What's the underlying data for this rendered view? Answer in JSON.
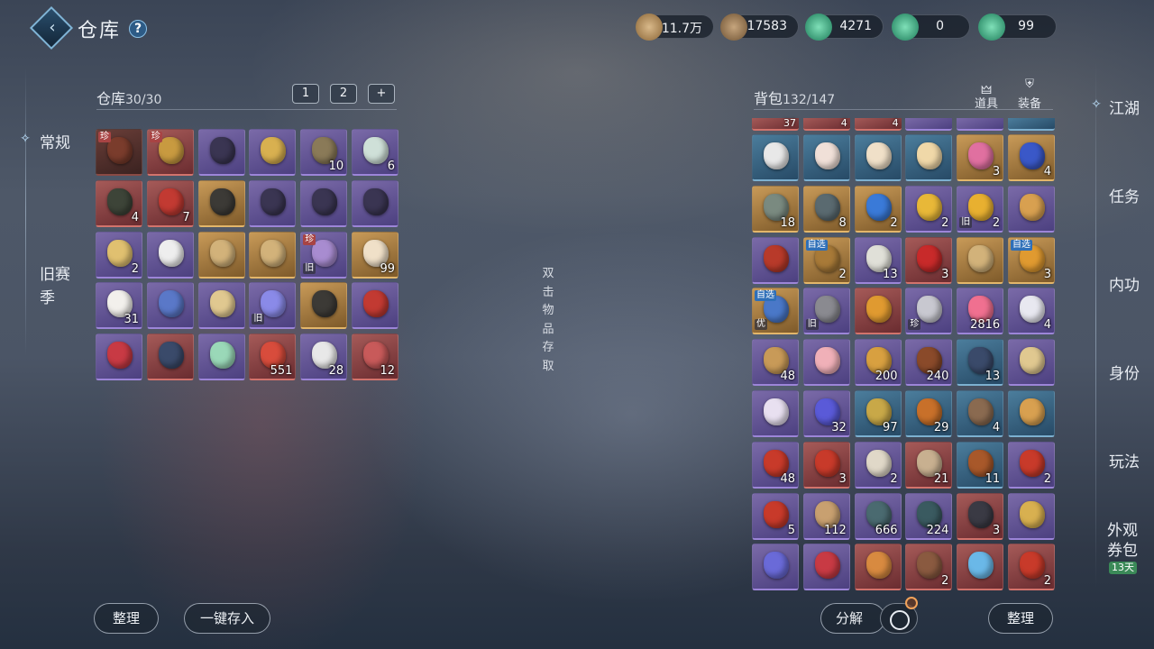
{
  "header": {
    "title": "仓库",
    "help_icon": "?"
  },
  "currencies": [
    {
      "icon": "scroll-currency-icon",
      "value": "11.7万"
    },
    {
      "icon": "coin-currency-icon",
      "value": "17583"
    },
    {
      "icon": "jade-currency-icon",
      "value": "4271"
    },
    {
      "icon": "jade-currency-icon",
      "value": "0"
    },
    {
      "icon": "jade-currency-icon",
      "value": "99"
    }
  ],
  "left_tabs": [
    "常规",
    "旧赛季"
  ],
  "warehouse": {
    "title": "仓库",
    "count": "30/30",
    "filters": [
      "1",
      "2",
      "+"
    ],
    "items": [
      {
        "q": "dim",
        "tag": "珍",
        "num": "",
        "c": "#7a3c2c"
      },
      {
        "q": "red",
        "tag": "珍",
        "num": "",
        "c": "#c89a40"
      },
      {
        "q": "purple",
        "tag": "",
        "num": "",
        "c": "#3a3552"
      },
      {
        "q": "purple",
        "tag": "",
        "num": "",
        "c": "#d8b050"
      },
      {
        "q": "purple",
        "tag": "",
        "num": "10",
        "c": "#8a7a58"
      },
      {
        "q": "purple",
        "tag": "",
        "num": "6",
        "c": "#cfe0d8"
      },
      {
        "q": "red",
        "tag": "",
        "num": "4",
        "c": "#3d4438"
      },
      {
        "q": "red",
        "tag": "",
        "num": "7",
        "c": "#c23a32"
      },
      {
        "q": "gold",
        "tag": "",
        "num": "",
        "c": "#3c3a36"
      },
      {
        "q": "purple",
        "tag": "",
        "num": "",
        "c": "#3a3552"
      },
      {
        "q": "purple",
        "tag": "",
        "num": "",
        "c": "#3a3552"
      },
      {
        "q": "purple",
        "tag": "",
        "num": "",
        "c": "#3a3552"
      },
      {
        "q": "purple",
        "tag": "",
        "num": "2",
        "c": "#e0c070"
      },
      {
        "q": "purple",
        "tag": "",
        "num": "",
        "c": "#eeeeee"
      },
      {
        "q": "gold",
        "tag": "",
        "num": "",
        "c": "#d2b27a"
      },
      {
        "q": "gold",
        "tag": "",
        "num": "",
        "c": "#d2b27a"
      },
      {
        "q": "purple",
        "tag": "珍",
        "tag2": "旧",
        "num": "",
        "c": "#a88cd0"
      },
      {
        "q": "gold",
        "tag": "",
        "num": "99",
        "c": "#f0e0c8"
      },
      {
        "q": "purple",
        "tag": "",
        "num": "31",
        "c": "#f2f0ec"
      },
      {
        "q": "purple",
        "tag": "",
        "num": "",
        "c": "#5a78c8"
      },
      {
        "q": "purple",
        "tag": "",
        "num": "",
        "c": "#e0c890"
      },
      {
        "q": "purple",
        "tag": "",
        "tag2": "旧",
        "num": "",
        "c": "#8a8ae8"
      },
      {
        "q": "gold",
        "tag": "",
        "num": "",
        "c": "#3c3a36"
      },
      {
        "q": "purple",
        "tag": "",
        "num": "",
        "c": "#c23a32"
      },
      {
        "q": "purple",
        "tag": "",
        "num": "",
        "c": "#c83a44"
      },
      {
        "q": "red",
        "tag": "",
        "num": "",
        "c": "#3a4a6a"
      },
      {
        "q": "purple",
        "tag": "",
        "num": "",
        "c": "#9ad8b8"
      },
      {
        "q": "red",
        "tag": "",
        "num": "551",
        "c": "#d84c3c"
      },
      {
        "q": "purple",
        "tag": "",
        "num": "28",
        "c": "#e8e8e8"
      },
      {
        "q": "red",
        "tag": "",
        "num": "12",
        "c": "#c85a5a"
      }
    ]
  },
  "middle_hint": [
    "双",
    "击",
    "物",
    "品",
    "存",
    "取"
  ],
  "bag": {
    "title": "背包",
    "count": "132/147",
    "categories": [
      "道具",
      "装备"
    ],
    "partial_row": [
      {
        "q": "red",
        "num": "37"
      },
      {
        "q": "red",
        "num": "4"
      },
      {
        "q": "red",
        "num": "4"
      },
      {
        "q": "purple",
        "num": ""
      },
      {
        "q": "purple",
        "num": ""
      },
      {
        "q": "blue",
        "num": ""
      }
    ],
    "items": [
      {
        "q": "blue",
        "num": "",
        "c": "#e8e8e8"
      },
      {
        "q": "blue",
        "num": "",
        "c": "#f0e0d8"
      },
      {
        "q": "blue",
        "num": "",
        "c": "#f0e0c8"
      },
      {
        "q": "blue",
        "num": "",
        "c": "#f0d8a8"
      },
      {
        "q": "gold",
        "num": "3",
        "c": "#e070a0"
      },
      {
        "q": "gold",
        "num": "4",
        "c": "#3a58c8"
      },
      {
        "q": "gold",
        "num": "18",
        "c": "#7a8a80"
      },
      {
        "q": "gold",
        "num": "8",
        "c": "#5a6a70"
      },
      {
        "q": "gold",
        "num": "2",
        "c": "#3a7ad8"
      },
      {
        "q": "purple",
        "num": "2",
        "c": "#e8b838"
      },
      {
        "q": "purple",
        "num": "2",
        "tag2": "旧",
        "c": "#e8b030"
      },
      {
        "q": "purple",
        "num": "",
        "c": "#d8a050"
      },
      {
        "q": "purple",
        "num": "",
        "c": "#b83a2a"
      },
      {
        "q": "gold",
        "num": "2",
        "tag": "自选",
        "c": "#a87a38"
      },
      {
        "q": "purple",
        "num": "13",
        "c": "#e0e0d8"
      },
      {
        "q": "red",
        "num": "3",
        "c": "#c82a2a"
      },
      {
        "q": "gold",
        "num": "",
        "c": "#d2b27a"
      },
      {
        "q": "gold",
        "num": "3",
        "tag": "自选",
        "c": "#e09a30"
      },
      {
        "q": "gold",
        "num": "",
        "tag": "自选",
        "tag2": "优",
        "c": "#4a78c8"
      },
      {
        "q": "purple",
        "num": "",
        "tag2": "旧",
        "c": "#8a8a90"
      },
      {
        "q": "red",
        "num": "",
        "c": "#e09a30"
      },
      {
        "q": "purple",
        "num": "",
        "tag2": "珍",
        "c": "#c8c8d0"
      },
      {
        "q": "purple",
        "num": "2816",
        "c": "#f07090"
      },
      {
        "q": "purple",
        "num": "4",
        "c": "#e8e8f0"
      },
      {
        "q": "purple",
        "num": "48",
        "c": "#c89a58"
      },
      {
        "q": "purple",
        "num": "",
        "c": "#f0b0b8"
      },
      {
        "q": "purple",
        "num": "200",
        "c": "#d8a040"
      },
      {
        "q": "purple",
        "num": "240",
        "c": "#8a4a2a"
      },
      {
        "q": "blue",
        "num": "13",
        "c": "#3a4a6a"
      },
      {
        "q": "purple",
        "num": "",
        "c": "#e0c890"
      },
      {
        "q": "purple",
        "num": "",
        "c": "#e8e0f0"
      },
      {
        "q": "purple",
        "num": "32",
        "c": "#5a5ad8"
      },
      {
        "q": "blue",
        "num": "97",
        "c": "#c8a848"
      },
      {
        "q": "blue",
        "num": "29",
        "c": "#c8702a"
      },
      {
        "q": "blue",
        "num": "4",
        "c": "#8a6a50"
      },
      {
        "q": "blue",
        "num": "",
        "c": "#d8a050"
      },
      {
        "q": "purple",
        "num": "48",
        "c": "#c83a2a"
      },
      {
        "q": "red",
        "num": "3",
        "c": "#c83a2a"
      },
      {
        "q": "purple",
        "num": "2",
        "c": "#e0d8c8"
      },
      {
        "q": "red",
        "num": "21",
        "c": "#c8b090"
      },
      {
        "q": "blue",
        "num": "11",
        "c": "#a8582a"
      },
      {
        "q": "purple",
        "num": "2",
        "c": "#c83a2a"
      },
      {
        "q": "purple",
        "num": "5",
        "c": "#c83a2a"
      },
      {
        "q": "purple",
        "num": "112",
        "c": "#c8a070"
      },
      {
        "q": "purple",
        "num": "666",
        "c": "#4a6a70"
      },
      {
        "q": "purple",
        "num": "224",
        "c": "#3a5a60"
      },
      {
        "q": "red",
        "num": "3",
        "c": "#3a3a44"
      },
      {
        "q": "purple",
        "num": "",
        "c": "#d8b050"
      },
      {
        "q": "purple",
        "num": "",
        "c": "#6a6ad8"
      },
      {
        "q": "purple",
        "num": "",
        "c": "#c83a44"
      },
      {
        "q": "red",
        "num": "",
        "c": "#d88a40"
      },
      {
        "q": "red",
        "num": "2",
        "c": "#8a5a40"
      },
      {
        "q": "red",
        "num": "",
        "c": "#6ab8e8"
      },
      {
        "q": "red",
        "num": "2",
        "c": "#c83a2a"
      }
    ]
  },
  "right_tabs": [
    "江湖",
    "任务",
    "内功",
    "身份",
    "玩法",
    "外观券包"
  ],
  "right_tab_badge": "13天",
  "buttons": {
    "sort_left": "整理",
    "deposit_all": "一键存入",
    "decompose": "分解",
    "sort_right": "整理"
  }
}
